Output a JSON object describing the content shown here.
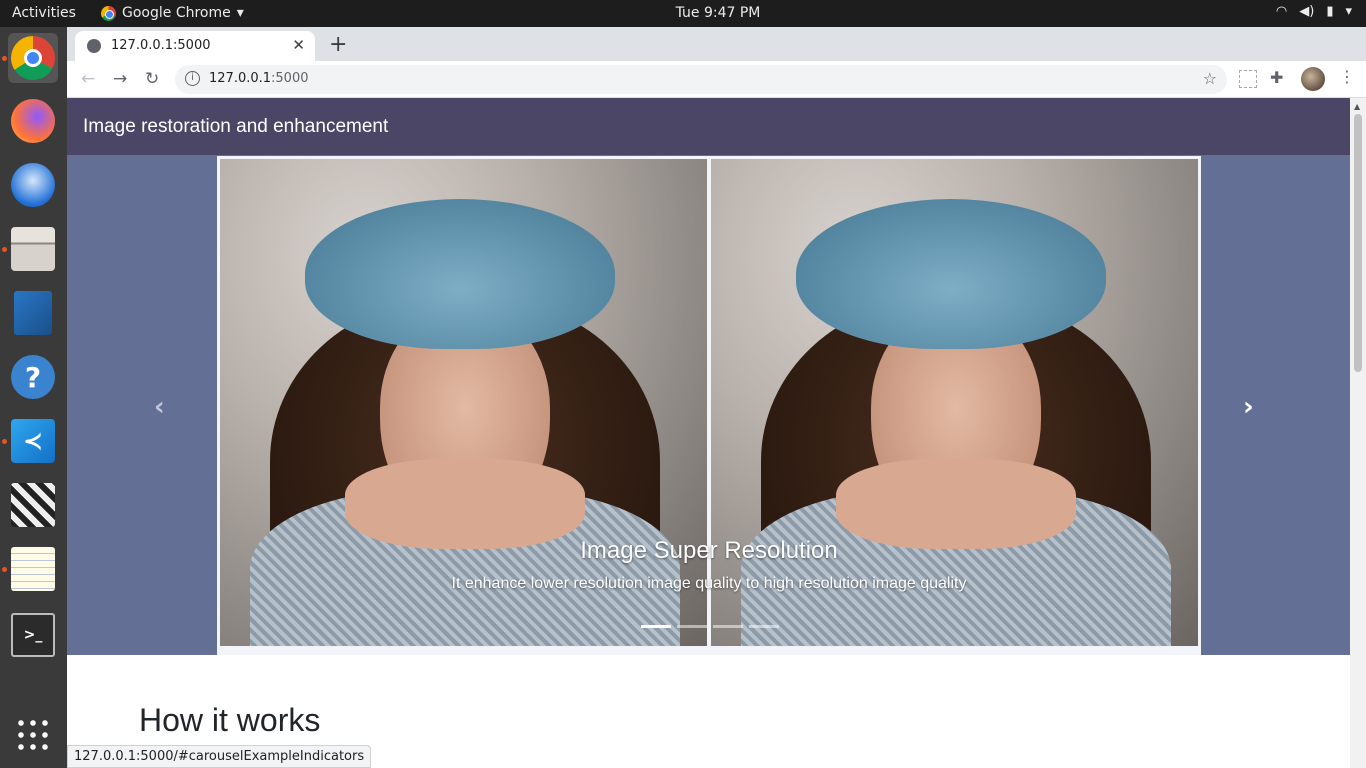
{
  "system": {
    "activities": "Activities",
    "app_name": "Google Chrome",
    "clock": "Tue  9:47 PM"
  },
  "browser": {
    "tab_title": "127.0.0.1:5000",
    "url_host": "127.0.0.1",
    "url_port": ":5000",
    "status_url": "127.0.0.1:5000/#carouselExampleIndicators"
  },
  "page": {
    "brand": "Image restoration and enhancement",
    "carousel": {
      "caption_title": "Image Super Resolution",
      "caption_text": "It enhance lower resolution image quality to high resolution image quality",
      "slide_count": 4,
      "active_slide": 1
    },
    "section_title": "How it works"
  },
  "colors": {
    "navbar": "#4b4566",
    "hero_bg": "#646f96",
    "dock": "#3a3a3a"
  }
}
